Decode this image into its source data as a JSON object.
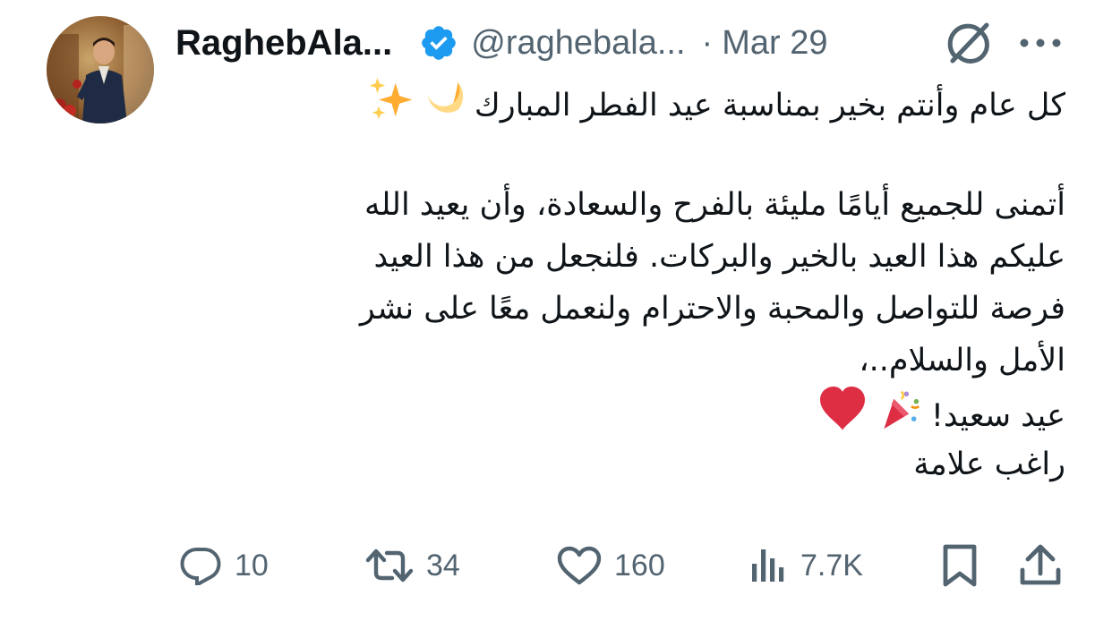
{
  "tweet": {
    "display_name": "RaghebAla...",
    "handle": "@raghebala...",
    "separator": "·",
    "date": "Mar 29",
    "text_line_1": "كل عام وأنتم بخير بمناسبة عيد الفطر المبارك",
    "paragraph_lines": [
      "أتمنى للجميع أيامًا مليئة بالفرح والسعادة، وأن يعيد الله",
      "عليكم هذا العيد بالخير والبركات. فلنجعل من هذا العيد",
      "فرصة للتواصل والمحبة والاحترام ولنعمل معًا على نشر",
      "الأمل والسلام..،"
    ],
    "greeting": "عيد سعيد!",
    "signature": "راغب علامة"
  },
  "icons": {
    "verified": "verified-badge-icon",
    "grok": "grok-icon",
    "more": "more-icon",
    "moon": "crescent-moon-emoji",
    "sparkles": "sparkles-emoji",
    "party": "party-popper-emoji",
    "heart": "red-heart-emoji",
    "reply": "reply-icon",
    "retweet": "retweet-icon",
    "like": "like-icon",
    "views": "views-icon",
    "bookmark": "bookmark-icon",
    "share": "share-icon"
  },
  "actions": {
    "replies": "10",
    "retweets": "34",
    "likes": "160",
    "views": "7.7K"
  },
  "colors": {
    "verified": "#1d9bf0",
    "text": "#0f1419",
    "secondary": "#536471",
    "heart": "#dd2e44",
    "moon": "#ffd983"
  }
}
